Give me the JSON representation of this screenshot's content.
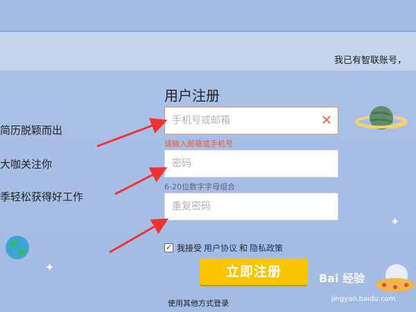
{
  "header": {
    "login_link": "我已有智联账号，"
  },
  "slogans": [
    "简历脱颖而出",
    "大咖关注你",
    "季轻松获得好工作"
  ],
  "form": {
    "title": "用户注册",
    "account_placeholder": "手机号或邮箱",
    "account_error": "请输入邮箱或手机号",
    "password_placeholder": "密码",
    "password_hint": "6-20位数字字母组合",
    "confirm_placeholder": "重复密码",
    "agree_prefix": "我接受",
    "agree_user_agreement": "用户协议",
    "agree_and": "和",
    "agree_privacy": "隐私政策",
    "submit_label": "立即注册",
    "other_login": "使用其他方式登录"
  },
  "watermark": {
    "text": "Bai 经验",
    "sub": "jingyan.baidu.com"
  },
  "colors": {
    "error": "#f05a2a",
    "submit": "#f9c400",
    "arrow": "#ee3333"
  }
}
